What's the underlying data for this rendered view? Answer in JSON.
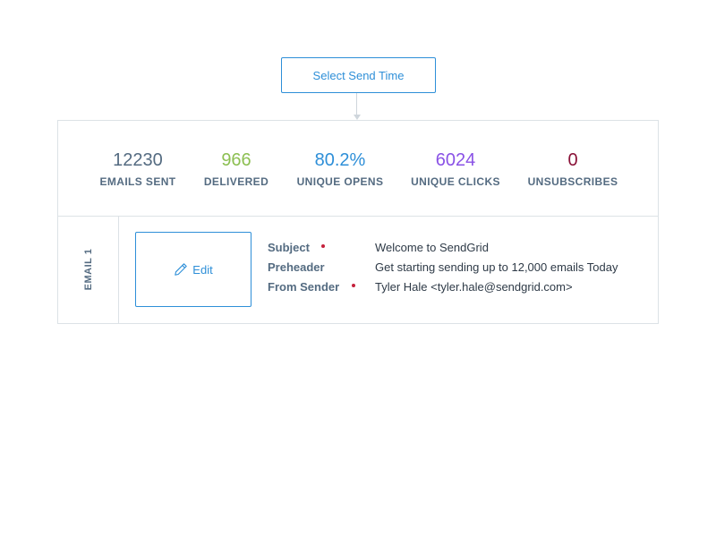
{
  "header": {
    "select_send_time_label": "Select Send Time"
  },
  "stats": [
    {
      "value": "12230",
      "label": "EMAILS SENT",
      "color": "#546b81"
    },
    {
      "value": "966",
      "label": "DELIVERED",
      "color": "#8cbf52"
    },
    {
      "value": "80.2%",
      "label": "UNIQUE OPENS",
      "color": "#2e8fd8"
    },
    {
      "value": "6024",
      "label": "UNIQUE CLICKS",
      "color": "#8a52e6"
    },
    {
      "value": "0",
      "label": "UNSUBSCRIBES",
      "color": "#8a1238"
    }
  ],
  "email": {
    "tab_label": "EMAIL 1",
    "edit_label": "Edit",
    "edit_icon": "pencil-icon",
    "fields": [
      {
        "label": "Subject",
        "required": true,
        "value": "Welcome to SendGrid"
      },
      {
        "label": "Preheader",
        "required": false,
        "value": "Get starting sending up to 12,000 emails Today"
      },
      {
        "label": "From Sender",
        "required": true,
        "value": "Tyler Hale <tyler.hale@sendgrid.com>"
      }
    ]
  },
  "colors": {
    "accent": "#2e8fd8",
    "border": "#dce2e6",
    "required_dot": "#c5213c",
    "label": "#546b81"
  }
}
